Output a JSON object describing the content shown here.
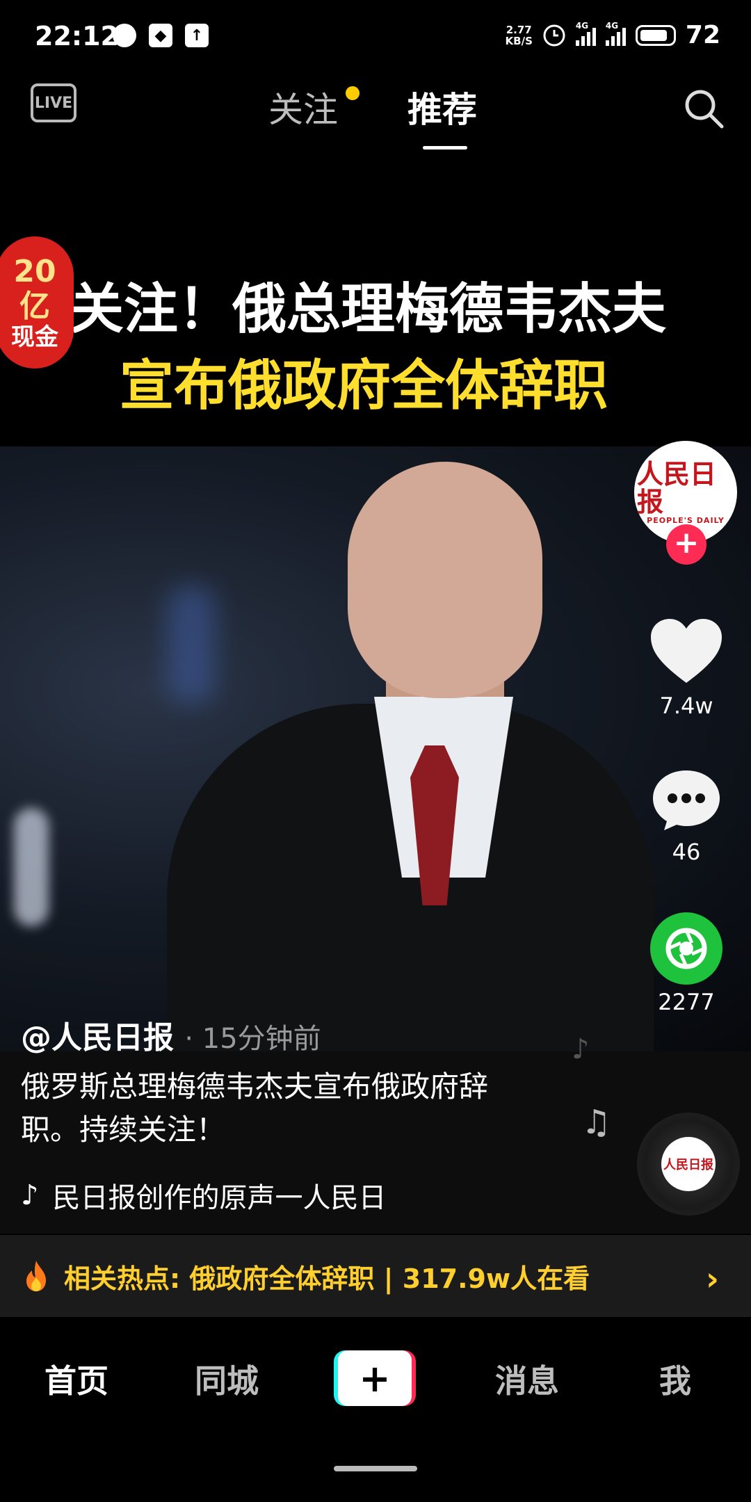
{
  "status_bar": {
    "time": "22:12",
    "net_speed_value": "2.77",
    "net_speed_unit": "KB/S",
    "network1": "4G",
    "network2": "4G",
    "battery": "72"
  },
  "top_nav": {
    "follow_tab": "关注",
    "recommend_tab": "推荐",
    "live_label": "LIVE",
    "follow_dot_color": "#ffcc00"
  },
  "video": {
    "headline_line1": "关注！俄总理梅德韦杰夫",
    "headline_line2": "宣布俄政府全体辞职",
    "badge_line1": "20",
    "badge_line2": "亿",
    "badge_line3": "现金"
  },
  "rail": {
    "avatar_cn": "人民日报",
    "avatar_en": "PEOPLE'S DAILY",
    "likes": "7.4w",
    "comments": "46",
    "shares": "2277",
    "follow_color": "#fe2c55",
    "share_color": "#1fc23c"
  },
  "caption": {
    "author": "@人民日报",
    "time": "· 15分钟前",
    "description": "俄罗斯总理梅德韦杰夫宣布俄政府辞职。持续关注！",
    "music": "民日报创作的原声一人民日"
  },
  "hot_topic": {
    "text": "相关热点: 俄政府全体辞职 | 317.9w人在看",
    "accent": "#ffcf2e"
  },
  "tabbar": {
    "home": "首页",
    "nearby": "同城",
    "create": "+",
    "messages": "消息",
    "me": "我"
  }
}
